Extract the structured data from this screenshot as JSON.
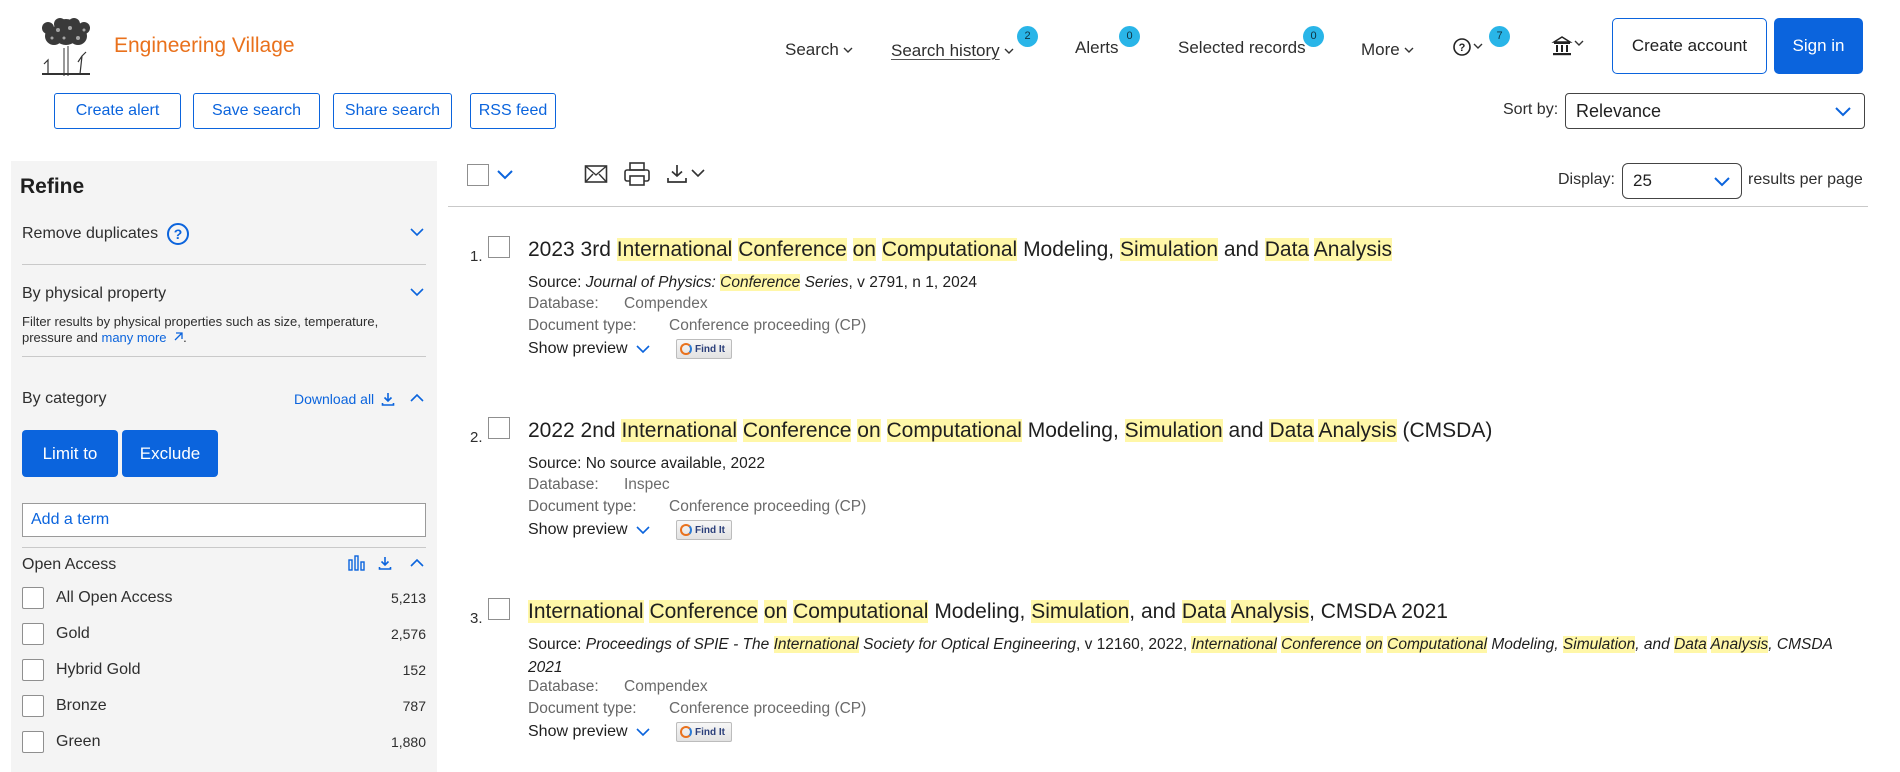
{
  "header": {
    "brand": "Engineering Village",
    "nav": {
      "search": "Search",
      "search_history": "Search history",
      "search_history_count": "2",
      "alerts": "Alerts",
      "alerts_count": "0",
      "selected_records": "Selected records",
      "selected_records_count": "0",
      "more": "More",
      "help_count": "7"
    },
    "create_account": "Create account",
    "sign_in": "Sign in"
  },
  "actions": {
    "create_alert": "Create alert",
    "save_search": "Save search",
    "share_search": "Share search",
    "rss_feed": "RSS feed",
    "sort_label": "Sort by:",
    "sort_value": "Relevance"
  },
  "sidebar": {
    "title": "Refine",
    "remove_duplicates": "Remove duplicates",
    "by_physical_property": "By physical property",
    "physical_desc_prefix": "Filter results by physical properties such as size, temperature, pressure and ",
    "many_more": "many more",
    "physical_desc_suffix": ".",
    "by_category": "By category",
    "download_all": "Download all",
    "limit_to": "Limit to",
    "exclude": "Exclude",
    "add_term_placeholder": "Add a term",
    "open_access": {
      "title": "Open Access",
      "items": [
        {
          "label": "All Open Access",
          "count": "5,213"
        },
        {
          "label": "Gold",
          "count": "2,576"
        },
        {
          "label": "Hybrid Gold",
          "count": "152"
        },
        {
          "label": "Bronze",
          "count": "787"
        },
        {
          "label": "Green",
          "count": "1,880"
        }
      ]
    }
  },
  "results_toolbar": {
    "display_label": "Display:",
    "display_value": "25",
    "per_page_label": "results per page"
  },
  "results": [
    {
      "num": "1.",
      "database": "Compendex",
      "doc_type": "Conference proceeding (CP)"
    },
    {
      "num": "2.",
      "database": "Inspec",
      "doc_type": "Conference proceeding (CP)"
    },
    {
      "num": "3.",
      "database": "Compendex",
      "doc_type": "Conference proceeding (CP)"
    }
  ],
  "labels": {
    "source": "Source:",
    "database": "Database:",
    "document_type": "Document type:",
    "show_preview": "Show preview",
    "find_it": "Find It"
  },
  "colors": {
    "accent": "#0b64dd",
    "brand": "#e9711c",
    "badge": "#29b5e8",
    "highlight": "#fff7a8",
    "sidebar_bg": "#f4f4f4"
  }
}
